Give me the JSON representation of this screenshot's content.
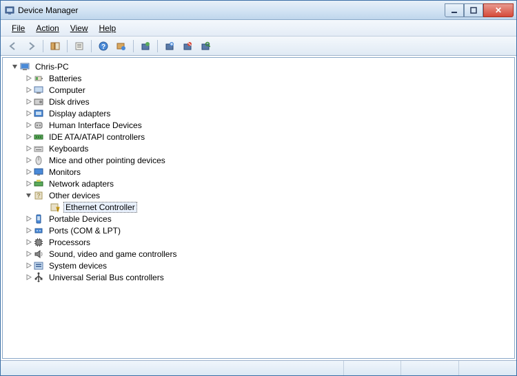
{
  "window": {
    "title": "Device Manager"
  },
  "menu": {
    "file": "File",
    "action": "Action",
    "view": "View",
    "help": "Help"
  },
  "tree": {
    "root": "Chris-PC",
    "items": [
      "Batteries",
      "Computer",
      "Disk drives",
      "Display adapters",
      "Human Interface Devices",
      "IDE ATA/ATAPI controllers",
      "Keyboards",
      "Mice and other pointing devices",
      "Monitors",
      "Network adapters",
      "Other devices",
      "Portable Devices",
      "Ports (COM & LPT)",
      "Processors",
      "Sound, video and game controllers",
      "System devices",
      "Universal Serial Bus controllers"
    ],
    "expanded_child": "Ethernet Controller"
  }
}
